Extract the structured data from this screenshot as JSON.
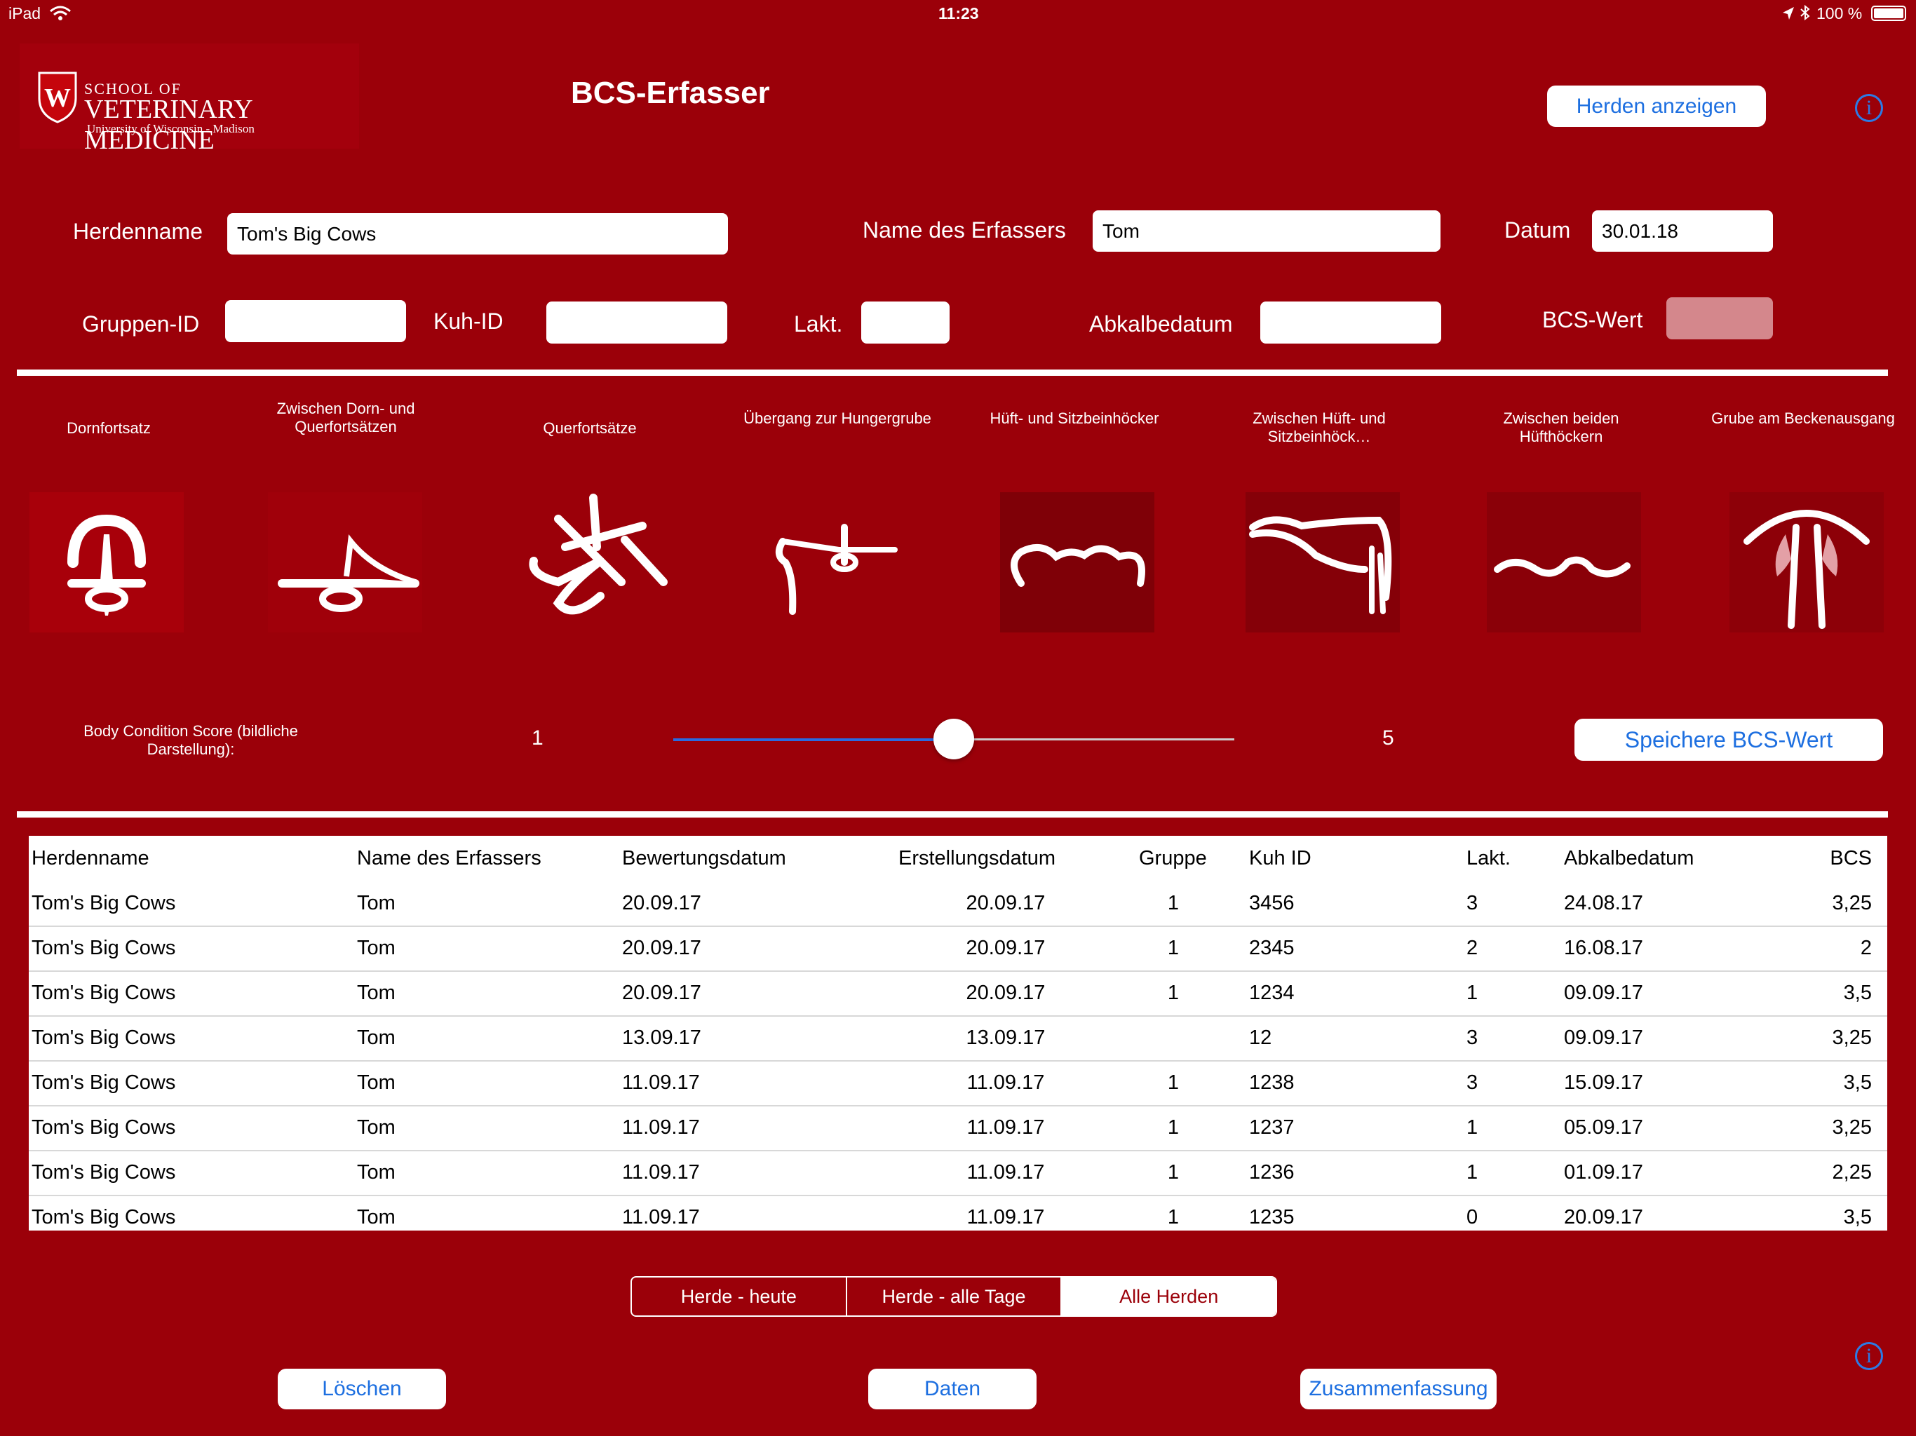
{
  "status_bar": {
    "device": "iPad",
    "time": "11:23",
    "battery": "100 %"
  },
  "header": {
    "logo_line1": "SCHOOL OF",
    "logo_line2": "VETERINARY MEDICINE",
    "logo_line3": "University of Wisconsin - Madison",
    "title": "BCS-Erfasser",
    "show_herds_button": "Herden anzeigen"
  },
  "form": {
    "herd_name_label": "Herdenname",
    "herd_name_value": "Tom's Big Cows",
    "assessor_label": "Name des Erfassers",
    "assessor_value": "Tom",
    "date_label": "Datum",
    "date_value": "30.01.18",
    "group_label": "Gruppen-ID",
    "group_value": "",
    "cow_label": "Kuh-ID",
    "cow_value": "",
    "lact_label": "Lakt.",
    "lact_value": "",
    "calving_label": "Abkalbedatum",
    "calving_value": "",
    "bcs_label": "BCS-Wert"
  },
  "anatomy": [
    {
      "label": "Dornfortsatz",
      "icon": "spinous-process-icon"
    },
    {
      "label": "Zwischen Dorn- und Querfortsätzen",
      "icon": "between-processes-icon"
    },
    {
      "label": "Querfortsätze",
      "icon": "transverse-processes-icon"
    },
    {
      "label": "Übergang zur Hungergrube",
      "icon": "hunger-pit-transition-icon"
    },
    {
      "label": "Hüft- und Sitzbeinhöcker",
      "icon": "hook-pin-bones-icon"
    },
    {
      "label": "Zwischen Hüft- und Sitzbeinhöck…",
      "icon": "between-hook-pin-icon"
    },
    {
      "label": "Zwischen beiden Hüfthöckern",
      "icon": "between-hooks-icon"
    },
    {
      "label": "Grube am Beckenausgang",
      "icon": "tailhead-pit-icon"
    }
  ],
  "slider": {
    "label": "Body Condition Score (bildliche Darstellung):",
    "min_label": "1",
    "max_label": "5",
    "fraction": 0.5,
    "save_button": "Speichere BCS-Wert"
  },
  "table": {
    "headers": [
      "Herdenname",
      "Name des Erfassers",
      "Bewertungsdatum",
      "Erstellungsdatum",
      "Gruppe",
      "Kuh ID",
      "Lakt.",
      "Abkalbedatum",
      "BCS"
    ],
    "rows": [
      [
        "Tom's Big Cows",
        "Tom",
        "20.09.17",
        "20.09.17",
        "1",
        "3456",
        "3",
        "24.08.17",
        "3,25"
      ],
      [
        "Tom's Big Cows",
        "Tom",
        "20.09.17",
        "20.09.17",
        "1",
        "2345",
        "2",
        "16.08.17",
        "2"
      ],
      [
        "Tom's Big Cows",
        "Tom",
        "20.09.17",
        "20.09.17",
        "1",
        "1234",
        "1",
        "09.09.17",
        "3,5"
      ],
      [
        "Tom's Big Cows",
        "Tom",
        "13.09.17",
        "13.09.17",
        "",
        "12",
        "3",
        "09.09.17",
        "3,25"
      ],
      [
        "Tom's Big Cows",
        "Tom",
        "11.09.17",
        "11.09.17",
        "1",
        "1238",
        "3",
        "15.09.17",
        "3,5"
      ],
      [
        "Tom's Big Cows",
        "Tom",
        "11.09.17",
        "11.09.17",
        "1",
        "1237",
        "1",
        "05.09.17",
        "3,25"
      ],
      [
        "Tom's Big Cows",
        "Tom",
        "11.09.17",
        "11.09.17",
        "1",
        "1236",
        "1",
        "01.09.17",
        "2,25"
      ],
      [
        "Tom's Big Cows",
        "Tom",
        "11.09.17",
        "11.09.17",
        "1",
        "1235",
        "0",
        "20.09.17",
        "3,5"
      ]
    ]
  },
  "segments": {
    "items": [
      "Herde - heute",
      "Herde - alle Tage",
      "Alle Herden"
    ],
    "selected": "Alle Herden"
  },
  "bottom": {
    "delete_button": "Löschen",
    "data_button": "Daten",
    "summary_button": "Zusammenfassung"
  },
  "colors": {
    "background": "#9b0009",
    "accent": "#1d6fe0",
    "slider_fill": "#2a6ae0"
  }
}
